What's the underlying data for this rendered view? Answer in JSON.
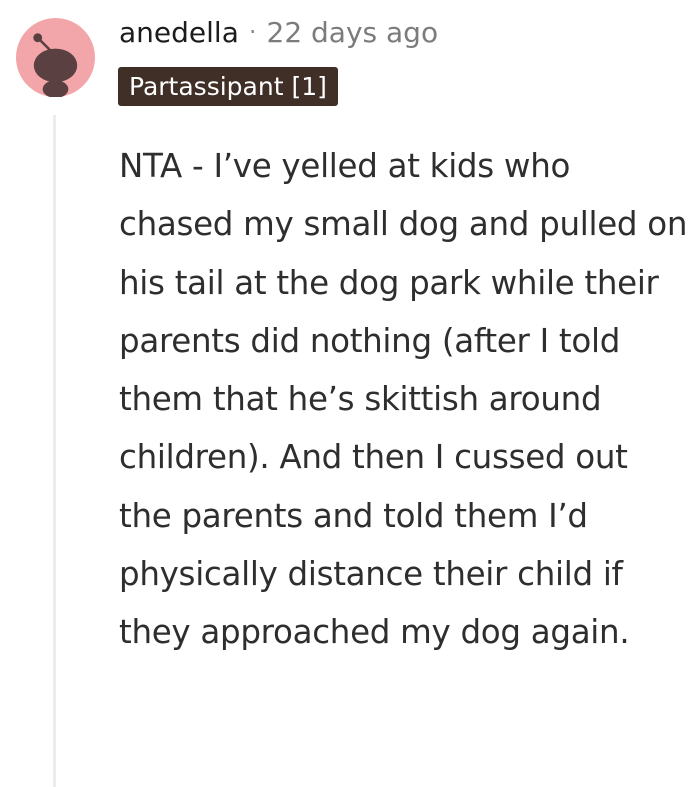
{
  "comment": {
    "author": "anedella",
    "separator": "·",
    "timestamp": "22 days ago",
    "flair": "Partassipant [1]",
    "body": "NTA - I’ve yelled at kids who chased my small dog and pulled on his tail at the dog park while their parents did nothing (after I told them that he’s skittish around children). And then I cussed out the parents and told them I’d physically distance their child if they approached my dog again."
  },
  "colors": {
    "avatar_bg": "#f3a6aa",
    "avatar_figure": "#5a4040",
    "flair_bg": "#3f2f27",
    "flair_text": "#ffffff",
    "thread_line": "#ececec"
  },
  "icons": {
    "avatar": "snoo-avatar-icon"
  }
}
